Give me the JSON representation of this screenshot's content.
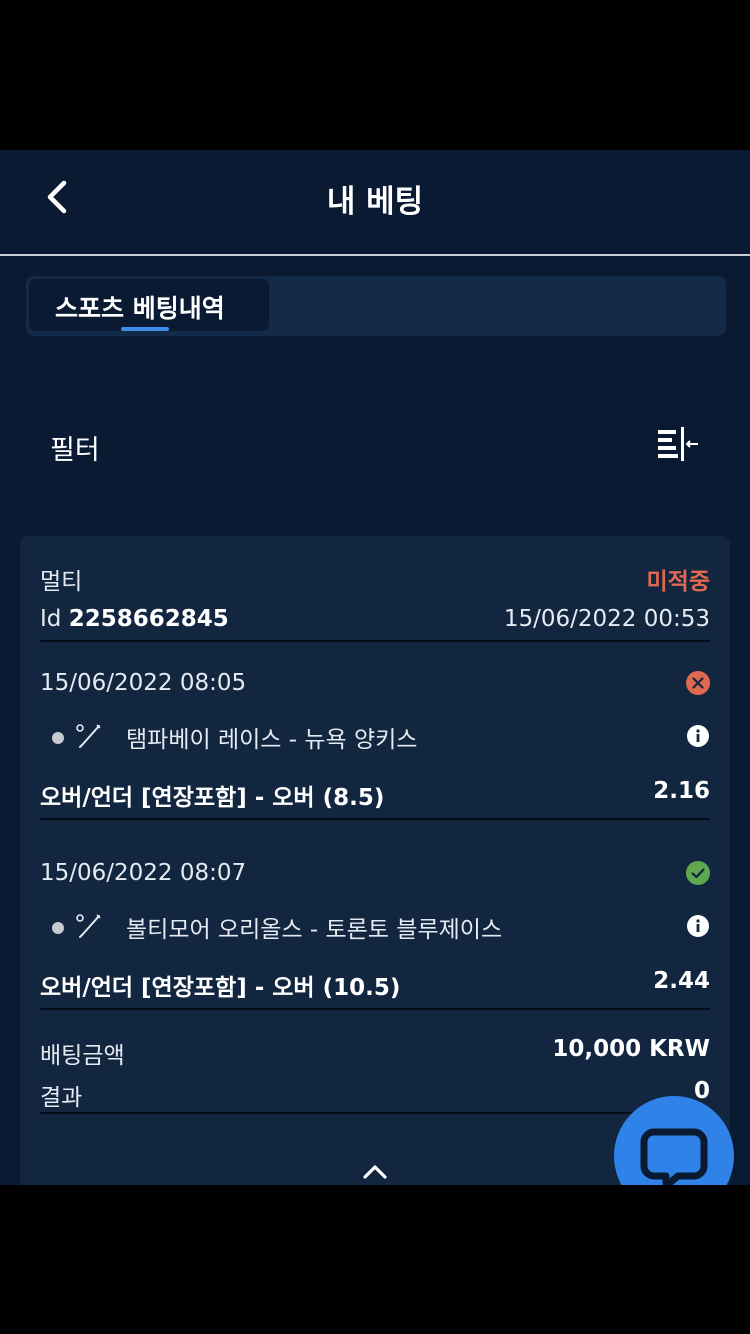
{
  "header": {
    "title": "내 베팅"
  },
  "tabs": [
    {
      "label": "스포츠 베팅내역",
      "active": true
    }
  ],
  "filter": {
    "label": "필터"
  },
  "bet": {
    "type": "멀티",
    "status": "미적중",
    "id_prefix": "Id",
    "id": "2258662845",
    "placed_at": "15/06/2022 00:53",
    "selections": [
      {
        "datetime": "15/06/2022 08:05",
        "result": "lost",
        "match": "탬파베이 레이스 - 뉴욕 양키스",
        "market": "오버/언더 [연장포함] - 오버 (8.5)",
        "odds": "2.16"
      },
      {
        "datetime": "15/06/2022 08:07",
        "result": "won",
        "match": "볼티모어 오리올스 - 토론토 블루제이스",
        "market": "오버/언더 [연장포함] - 오버 (10.5)",
        "odds": "2.44"
      }
    ],
    "stake_label": "배팅금액",
    "stake_value": "10,000 KRW",
    "result_label": "결과",
    "result_value": "0"
  },
  "icons": {
    "back": "chevron-left-icon",
    "filter": "filter-lines-icon",
    "lost": "x-circle-icon",
    "won": "check-circle-icon",
    "info": "info-icon",
    "sport": "baseball-bat-icon",
    "expand": "chevron-up-icon",
    "chat": "chat-bubble-icon"
  },
  "colors": {
    "background": "#0b1a33",
    "card": "#122640",
    "accent": "#3d8ce8",
    "lost": "#e0694f",
    "won": "#5fa84f",
    "chat": "#2f83e8"
  }
}
